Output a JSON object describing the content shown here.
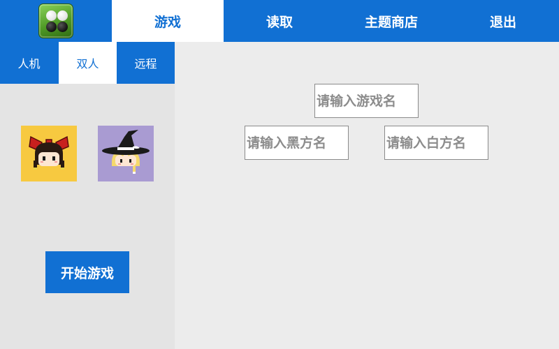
{
  "header": {
    "logo_icon": "othello-stones-icon",
    "tabs": [
      {
        "label": "游戏",
        "active": true
      },
      {
        "label": "读取",
        "active": false
      },
      {
        "label": "主题商店",
        "active": false
      },
      {
        "label": "退出",
        "active": false
      }
    ]
  },
  "sidebar": {
    "mode_tabs": [
      {
        "label": "人机",
        "active": false
      },
      {
        "label": "双人",
        "active": true
      },
      {
        "label": "远程",
        "active": false
      }
    ],
    "players": [
      {
        "icon": "player-avatar-red-bow-icon",
        "bg_color": "#f7c940"
      },
      {
        "icon": "player-avatar-witch-hat-icon",
        "bg_color": "#a99bd2"
      }
    ],
    "start_label": "开始游戏"
  },
  "form": {
    "game_name_placeholder": "请输入游戏名",
    "black_name_placeholder": "请输入黑方名",
    "white_name_placeholder": "请输入白方名"
  },
  "colors": {
    "accent": "#1170d3",
    "background": "#ececec",
    "panel": "#e4e4e4"
  }
}
